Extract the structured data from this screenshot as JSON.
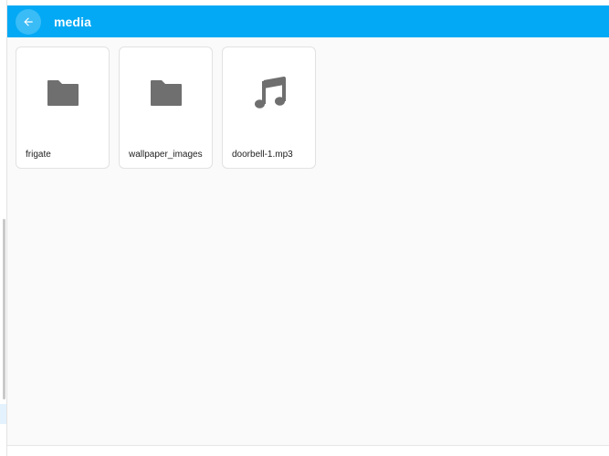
{
  "header": {
    "title": "media",
    "back_icon": "arrow-left-icon"
  },
  "colors": {
    "header_bg": "#03a9f4",
    "content_bg": "#fafafa",
    "icon": "#6f6f6f"
  },
  "items": [
    {
      "label": "frigate",
      "icon": "folder-icon"
    },
    {
      "label": "wallpaper_images",
      "icon": "folder-icon"
    },
    {
      "label": "doorbell-1.mp3",
      "icon": "music-note-icon"
    }
  ]
}
